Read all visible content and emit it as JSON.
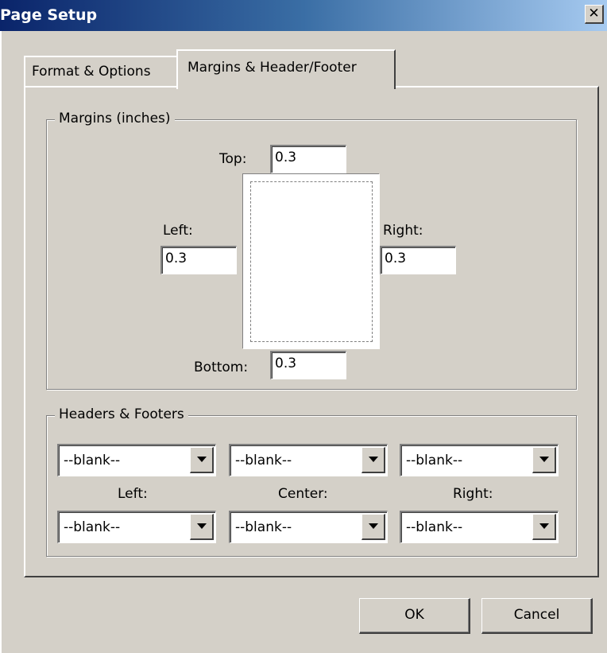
{
  "window": {
    "title": "Page Setup",
    "close_glyph": "✕"
  },
  "tabs": [
    {
      "label": "Format & Options",
      "selected": false
    },
    {
      "label": "Margins & Header/Footer",
      "selected": true
    }
  ],
  "margins": {
    "group_title": "Margins (inches)",
    "top_label": "Top:",
    "top_value": "0.3",
    "left_label": "Left:",
    "left_value": "0.3",
    "right_label": "Right:",
    "right_value": "0.3",
    "bottom_label": "Bottom:",
    "bottom_value": "0.3"
  },
  "headers_footers": {
    "group_title": "Headers & Footers",
    "header_left": "--blank--",
    "header_center": "--blank--",
    "header_right": "--blank--",
    "left_label": "Left:",
    "center_label": "Center:",
    "right_label": "Right:",
    "footer_left": "--blank--",
    "footer_center": "--blank--",
    "footer_right": "--blank--"
  },
  "buttons": {
    "ok": "OK",
    "cancel": "Cancel"
  }
}
